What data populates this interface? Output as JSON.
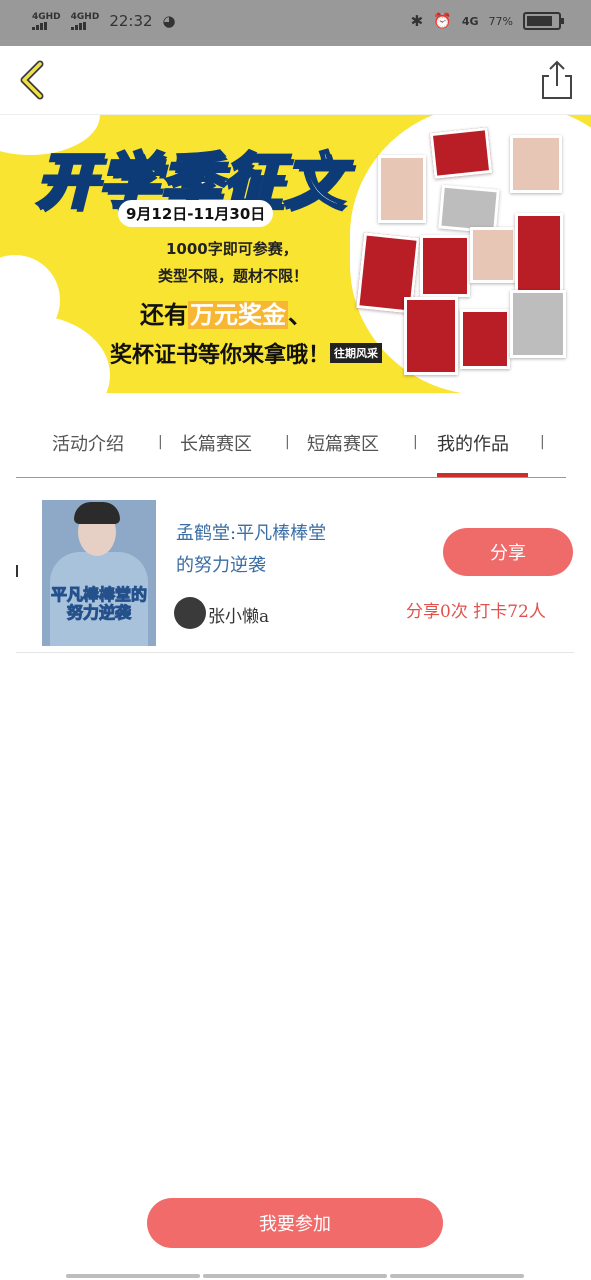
{
  "status_bar": {
    "sim1": "4GHD",
    "sim2": "4GHD",
    "time": "22:32",
    "network": "4G",
    "battery": "77%"
  },
  "banner": {
    "title": "开学季征文",
    "dates": "9月12日-11月30日",
    "line1": "1000字即可参赛，",
    "line2": "类型不限，题材不限！",
    "line3_pre": "还有",
    "line3_highlight": "万元奖金",
    "line3_post": "、",
    "line4": "奖杯证书等你来拿哦！",
    "past_label": "往期风采"
  },
  "tabs": [
    {
      "label": "活动介绍"
    },
    {
      "label": "长篇赛区"
    },
    {
      "label": "短篇赛区"
    },
    {
      "label": "我的作品"
    }
  ],
  "tab_separator": "|",
  "work": {
    "title": "孟鹤堂:平凡棒棒堂的努力逆袭",
    "title_line1": "孟鹤堂:平凡棒棒堂",
    "title_line2": "的努力逆袭",
    "cover_text": "平凡棒棒堂的努力逆袭",
    "author": "张小懒a",
    "share_label": "分享",
    "stats": "分享0次 打卡72人"
  },
  "join_label": "我要参加",
  "colors": {
    "accent": "#ee6b6a",
    "banner_yellow": "#f9e431",
    "tab_indicator": "#c9302c",
    "link_blue": "#3a6ea5"
  }
}
